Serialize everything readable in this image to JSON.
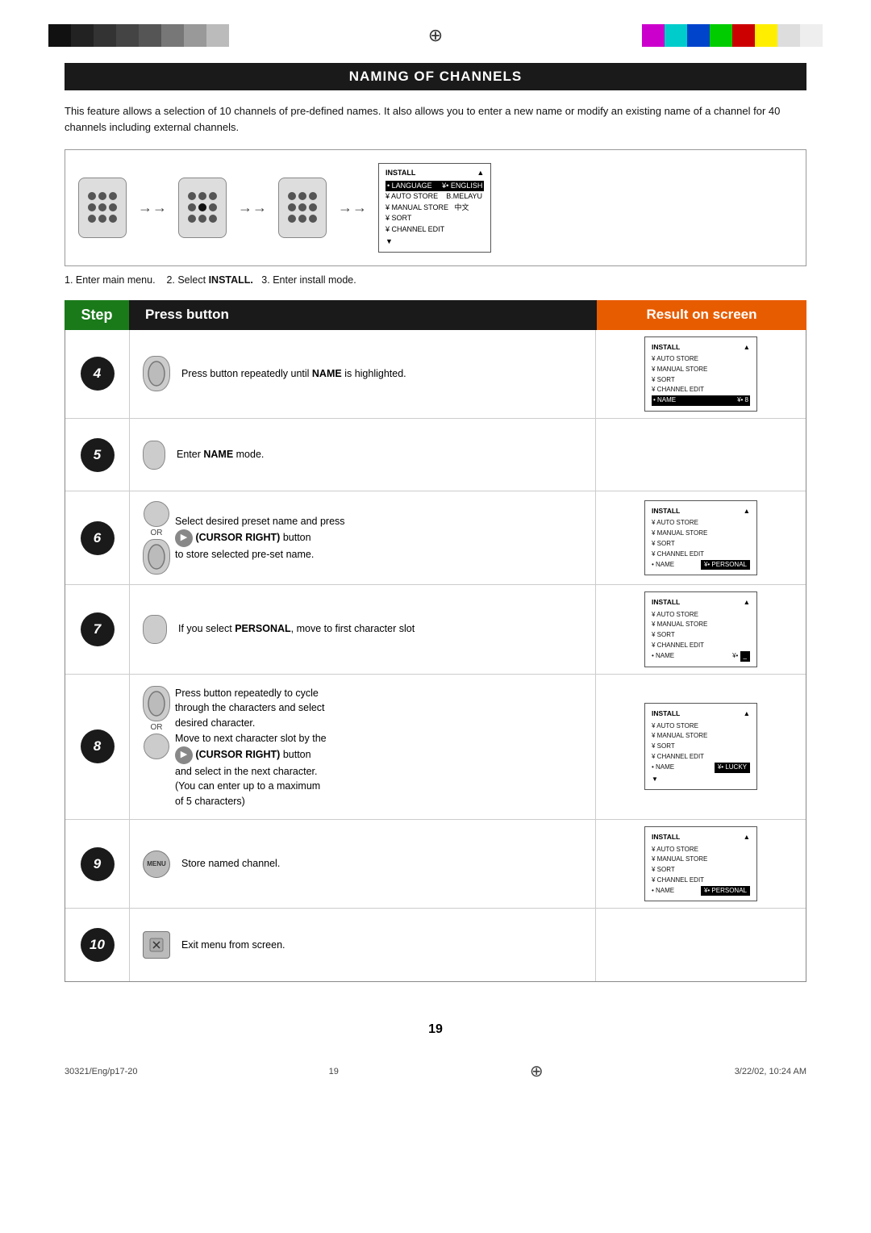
{
  "top": {
    "left_colors": [
      "#111",
      "#222",
      "#333",
      "#444",
      "#555",
      "#777",
      "#999",
      "#aaa"
    ],
    "right_colors": [
      "#cc00cc",
      "#00cccc",
      "#0000cc",
      "#00cc00",
      "#cc0000",
      "#ffff00",
      "#cccccc",
      "#eeeeee"
    ],
    "crosshair": "⊕"
  },
  "title": "Naming of Channels",
  "intro": "This feature allows a selection of 10 channels of pre-defined names. It also allows you to enter a new name or modify an existing name of a channel for 40 channels including external channels.",
  "setup_caption": "1. Enter main menu.   2. Select INSTALL.   3. Enter install mode.",
  "header": {
    "step_label": "Step",
    "press_label": "Press button",
    "result_label": "Result on screen"
  },
  "steps": [
    {
      "num": "4",
      "description": "Press button repeatedly until NAME is highlighted.",
      "description_bold": "NAME",
      "screen": {
        "title": "INSTALL",
        "items": [
          "¥ AUTO STORE",
          "¥ MANUAL STORE",
          "¥ SORT",
          "¥ CHANNEL EDIT",
          "• NAME"
        ],
        "right_val": "¥• 8"
      }
    },
    {
      "num": "5",
      "description": "Enter NAME mode.",
      "description_bold": "NAME",
      "screen": null
    },
    {
      "num": "6",
      "description": "Select desired preset name and press (CURSOR RIGHT) button to store selected pre-set name.",
      "description_bold": "CURSOR RIGHT",
      "screen": {
        "title": "INSTALL",
        "items": [
          "¥ AUTO STORE",
          "¥ MANUAL STORE",
          "¥ SORT",
          "¥ CHANNEL EDIT",
          "• NAME"
        ],
        "right_val": "PERSONAL"
      }
    },
    {
      "num": "7",
      "description": "If you select PERSONAL, move to first character slot",
      "description_bold": "PERSONAL",
      "screen": {
        "title": "INSTALL",
        "items": [
          "¥ AUTO STORE",
          "¥ MANUAL STORE",
          "¥ SORT",
          "¥ CHANNEL EDIT",
          "• NAME"
        ],
        "right_val": "¥• _"
      }
    },
    {
      "num": "8",
      "description": "Press button repeatedly to cycle through the characters and select desired character.\nMove to next character slot by the (CURSOR RIGHT) button and select in the next character.\n(You can enter up to a maximum of 5 characters)",
      "description_bold": "CURSOR RIGHT",
      "screen": {
        "title": "INSTALL",
        "items": [
          "¥ AUTO STORE",
          "¥ MANUAL STORE",
          "¥ SORT",
          "¥ CHANNEL EDIT",
          "• NAME"
        ],
        "right_val": "¥• LUCKY"
      }
    },
    {
      "num": "9",
      "description": "Store named channel.",
      "screen": {
        "title": "INSTALL",
        "items": [
          "¥ AUTO STORE",
          "¥ MANUAL STORE",
          "¥ SORT",
          "¥ CHANNEL EDIT",
          "• NAME"
        ],
        "right_val": "¥• PERSONAL"
      }
    },
    {
      "num": "10",
      "description": "Exit menu from screen.",
      "screen": null
    }
  ],
  "footer": {
    "left": "30321/Eng/p17-20",
    "center": "19",
    "right": "3/22/02, 10:24 AM"
  },
  "page_number": "19"
}
